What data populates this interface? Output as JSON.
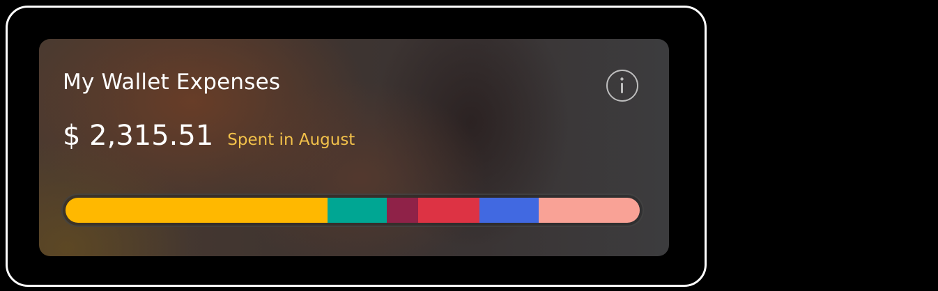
{
  "widget": {
    "title": "My Wallet Expenses",
    "amount": "$ 2,315.51",
    "amount_subtitle": "Spent in August",
    "info_icon": "info-icon"
  },
  "colors": {
    "subtitle": "#f2c14a",
    "text": "#ffffff"
  },
  "expense_bar": {
    "segments": [
      {
        "share_percent": 45.6,
        "color": "#ffb800"
      },
      {
        "share_percent": 10.4,
        "color": "#00a693"
      },
      {
        "share_percent": 5.4,
        "color": "#8f2248"
      },
      {
        "share_percent": 10.7,
        "color": "#dd3344"
      },
      {
        "share_percent": 10.3,
        "color": "#4169e1"
      },
      {
        "share_percent": 17.6,
        "color": "#f9a296"
      }
    ]
  }
}
